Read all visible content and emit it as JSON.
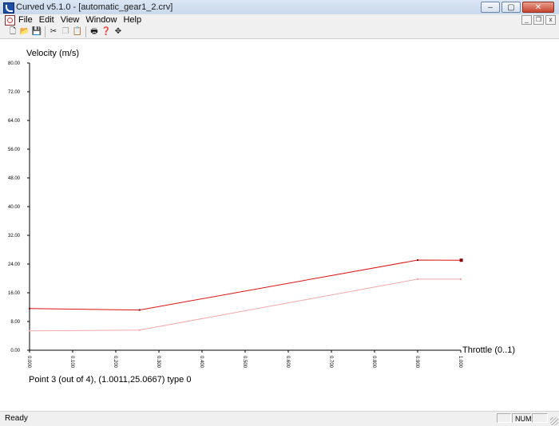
{
  "window": {
    "title": "Curved v5.1.0 - [automatic_gear1_2.crv]",
    "buttons": [
      "–",
      "▢",
      "✕"
    ]
  },
  "menu": {
    "items": [
      "File",
      "Edit",
      "View",
      "Window",
      "Help"
    ],
    "mdi_buttons": [
      "_",
      "❐",
      "x"
    ]
  },
  "toolbar": {
    "icons": [
      "new-file-icon",
      "open-folder-icon",
      "save-icon",
      "cut-icon",
      "copy-icon",
      "paste-icon",
      "print-icon",
      "help-pointer-icon",
      "move-icon"
    ]
  },
  "plot": {
    "y_axis_label": "Velocity (m/s)",
    "x_axis_label": "Throttle (0..1)",
    "point_info": "Point 3 (out of 4), (1.0011,25.0667) type 0"
  },
  "chart_data": {
    "type": "line",
    "xlabel": "Throttle (0..1)",
    "ylabel": "Velocity (m/s)",
    "xlim": [
      0,
      1
    ],
    "ylim": [
      0,
      80
    ],
    "x_ticks": [
      "0.000",
      "0.100",
      "0.200",
      "0.300",
      "0.400",
      "0.500",
      "0.600",
      "0.700",
      "0.800",
      "0.900",
      "1.000"
    ],
    "y_ticks": [
      "0.00",
      "8.00",
      "16.00",
      "24.00",
      "32.00",
      "40.00",
      "48.00",
      "56.00",
      "64.00",
      "72.00",
      "80.00"
    ],
    "series": [
      {
        "color": "#dd1111",
        "points": [
          [
            0.0,
            11.6
          ],
          [
            0.255,
            11.2
          ],
          [
            0.9,
            25.1
          ],
          [
            1.0011,
            25.0667
          ]
        ]
      },
      {
        "color": "#f2a8a8",
        "points": [
          [
            0.0,
            5.4
          ],
          [
            0.255,
            5.6
          ],
          [
            0.9,
            19.8
          ],
          [
            1.0,
            19.8
          ]
        ]
      }
    ],
    "selected_point": {
      "series": 0,
      "index": 3
    }
  },
  "status": {
    "text": "Ready",
    "num": "NUM"
  }
}
